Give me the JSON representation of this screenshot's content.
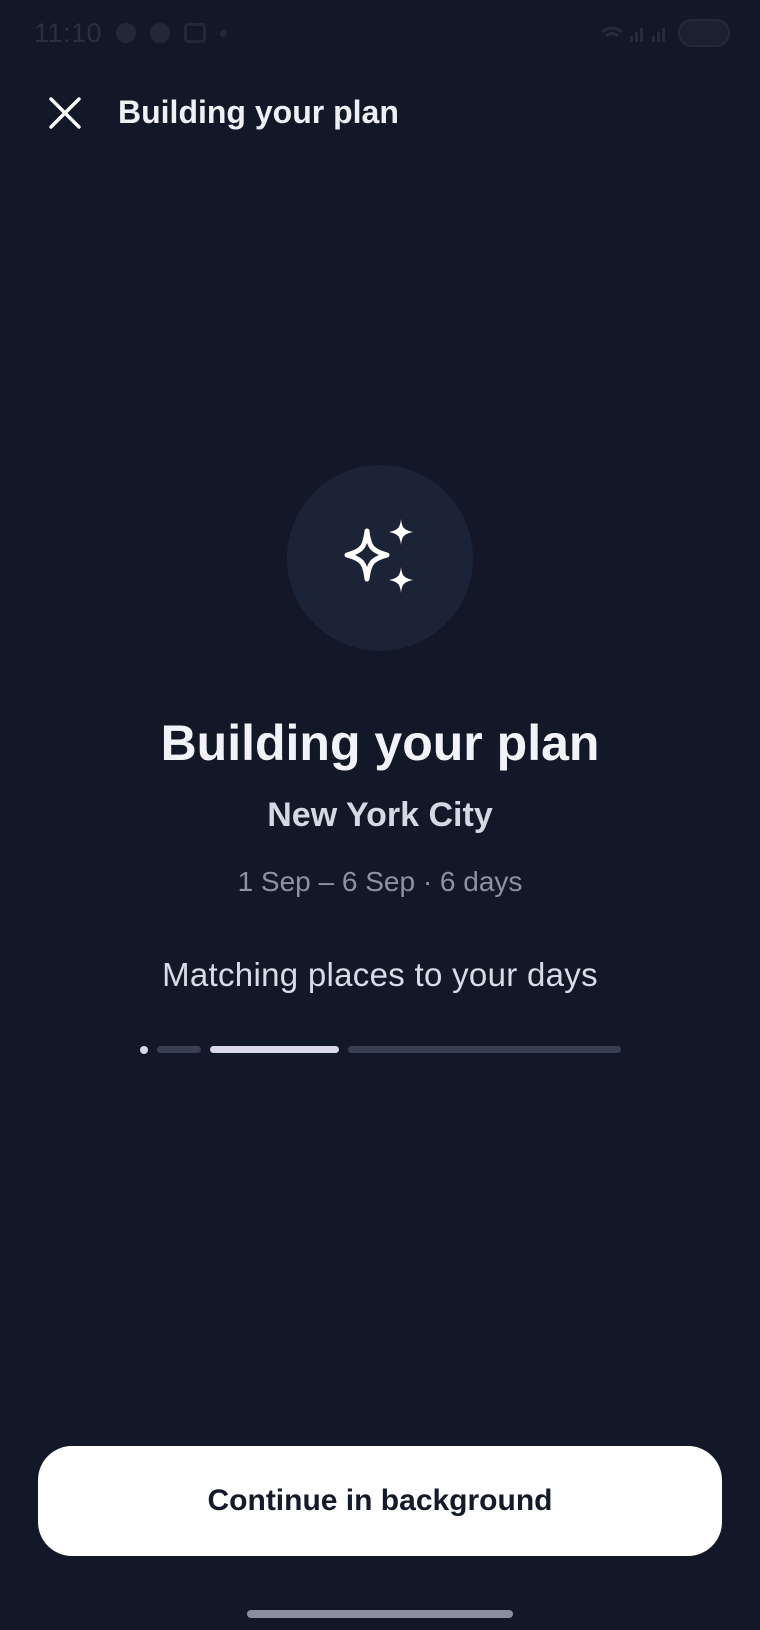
{
  "status_bar": {
    "time": "11:10",
    "icons": [
      "chat-bubble-icon",
      "circle-icon",
      "screenshot-icon",
      "dot-icon",
      "wifi-icon",
      "signal-icon",
      "battery-icon"
    ]
  },
  "header": {
    "close_icon": "close-icon",
    "title": "Building your plan"
  },
  "hero": {
    "icon": "sparkles-icon",
    "title": "Building your plan",
    "city": "New York City",
    "dates": "1 Sep – 6 Sep · 6 days",
    "step": "Matching places to your days"
  },
  "progress": {
    "steps_total": 4,
    "current_step": 3,
    "colors": {
      "active": "#d8d8e8",
      "inactive": "#3a4053"
    }
  },
  "actions": {
    "continue_label": "Continue in background"
  },
  "colors": {
    "background": "#131829",
    "badge": "#1b2336",
    "button_bg": "#ffffff",
    "button_text": "#151a2a"
  }
}
